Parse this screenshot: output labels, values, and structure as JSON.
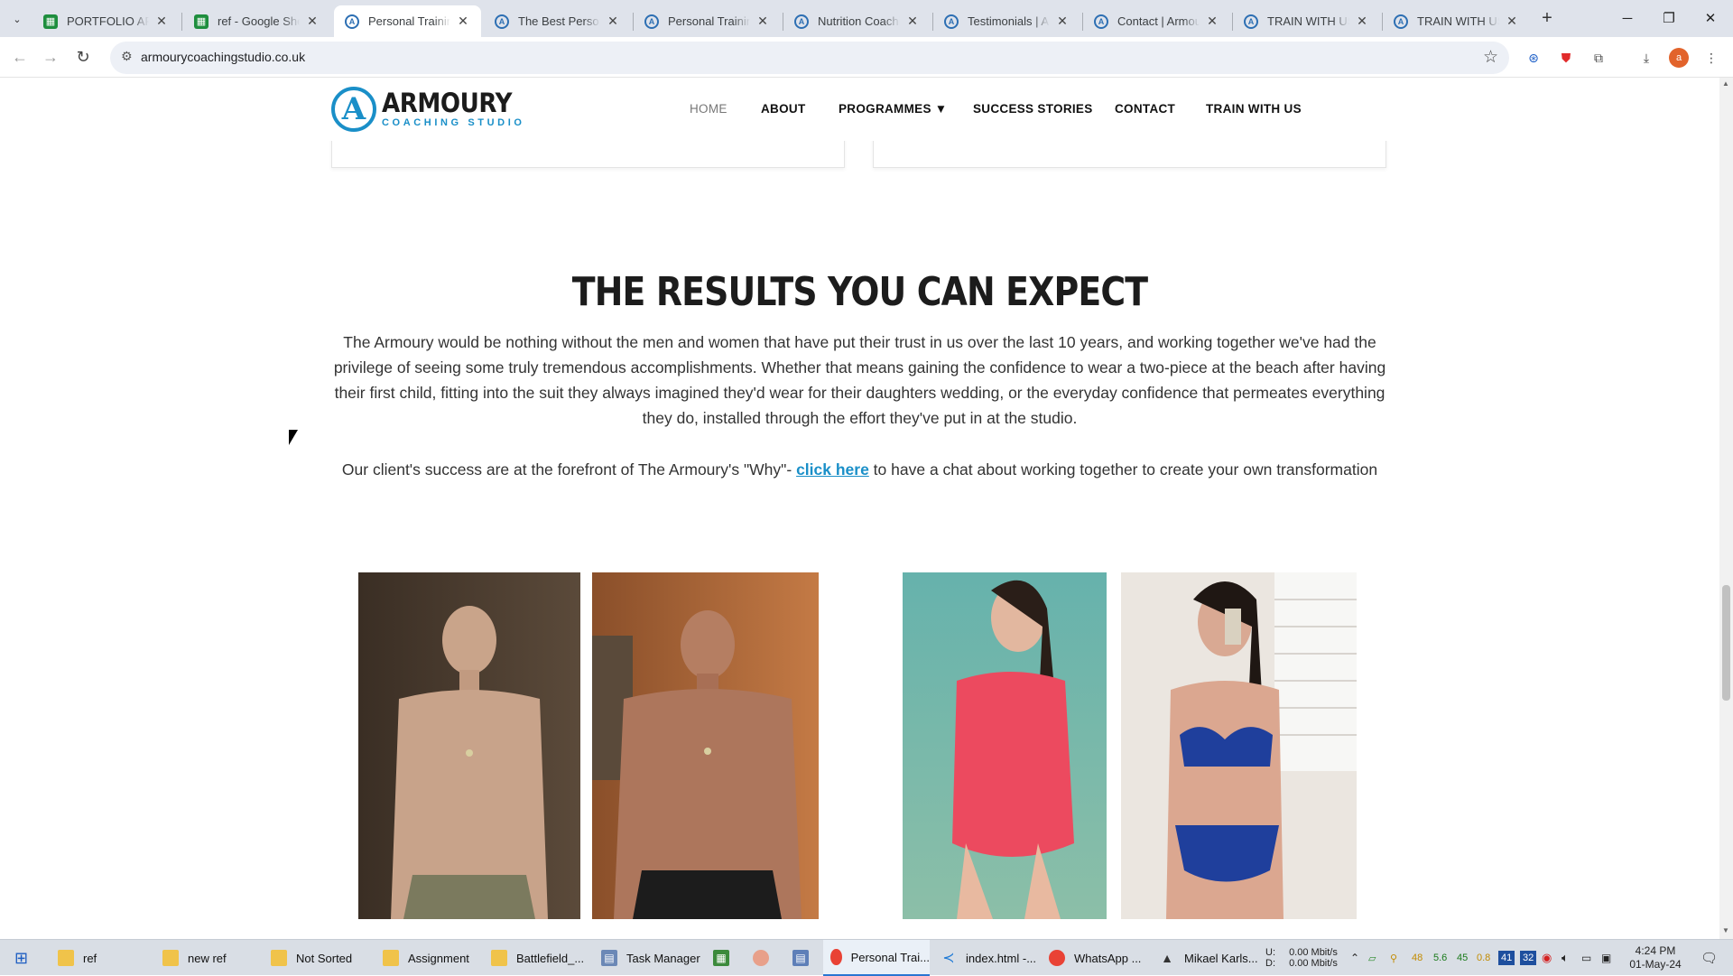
{
  "browser": {
    "tabs": [
      {
        "title": "PORTFOLIO AFTER",
        "icon": "sheets-icon",
        "active": false
      },
      {
        "title": "ref - Google Sheets",
        "icon": "sheets-icon",
        "active": false
      },
      {
        "title": "Personal Training",
        "icon": "armoury-logo-icon",
        "active": true
      },
      {
        "title": "The Best Personal",
        "icon": "armoury-logo-icon",
        "active": false
      },
      {
        "title": "Personal Training",
        "icon": "armoury-logo-icon",
        "active": false
      },
      {
        "title": "Nutrition Coaching",
        "icon": "armoury-logo-icon",
        "active": false
      },
      {
        "title": "Testimonials | Arm",
        "icon": "armoury-logo-icon",
        "active": false
      },
      {
        "title": "Contact | Armoury",
        "icon": "armoury-logo-icon",
        "active": false
      },
      {
        "title": "TRAIN WITH US",
        "icon": "armoury-logo-icon",
        "active": false
      },
      {
        "title": "TRAIN WITH US",
        "icon": "armoury-logo-icon",
        "active": false
      }
    ],
    "url": "armourycoachingstudio.co.uk",
    "profile_initial": "a"
  },
  "site": {
    "logo_title": "ARMOURY",
    "logo_subtitle": "COACHING STUDIO",
    "nav": {
      "home": "HOME",
      "about": "ABOUT",
      "programmes": "PROGRAMMES ▼",
      "success": "SUCCESS STORIES",
      "contact": "CONTACT",
      "train": "TRAIN WITH US"
    }
  },
  "section": {
    "heading": "THE RESULTS YOU CAN EXPECT",
    "paragraph": "The Armoury would be nothing without the men and women that have put their trust in us over the last 10 years, and working together we've had the privilege of seeing some truly tremendous accomplishments.  Whether that means gaining the confidence to wear a two-piece at the beach after having their first child, fitting into the suit they always imagined they'd wear for their daughters wedding, or the everyday confidence that permeates everything they do, installed through the effort they've put in at the studio.",
    "cta_before": "Our client's success are at the forefront of The Armoury's \"Why\"- ",
    "cta_link": "click here",
    "cta_after": " to have a chat about working together to create your own transformation"
  },
  "photos": [
    {
      "name": "man-before-photo"
    },
    {
      "name": "man-after-photo"
    },
    {
      "name": "woman-before-photo"
    },
    {
      "name": "woman-after-photo"
    }
  ],
  "taskbar": {
    "items": [
      "ref",
      "new ref",
      "Not Sorted",
      "Assignment",
      "Battlefield_...",
      "Task Manager",
      "Personal Trai...",
      "index.html -...",
      "WhatsApp ...",
      "Mikael Karls..."
    ],
    "network_up": "U:",
    "network_down": "D:",
    "net_up_val": "0.00 Mbit/s",
    "net_down_val": "0.00 Mbit/s",
    "tray_nums": [
      "48",
      "5.6",
      "45",
      "0.8"
    ],
    "tray_badges": [
      "41",
      "32"
    ],
    "time": "4:24 PM",
    "date": "01-May-24"
  }
}
